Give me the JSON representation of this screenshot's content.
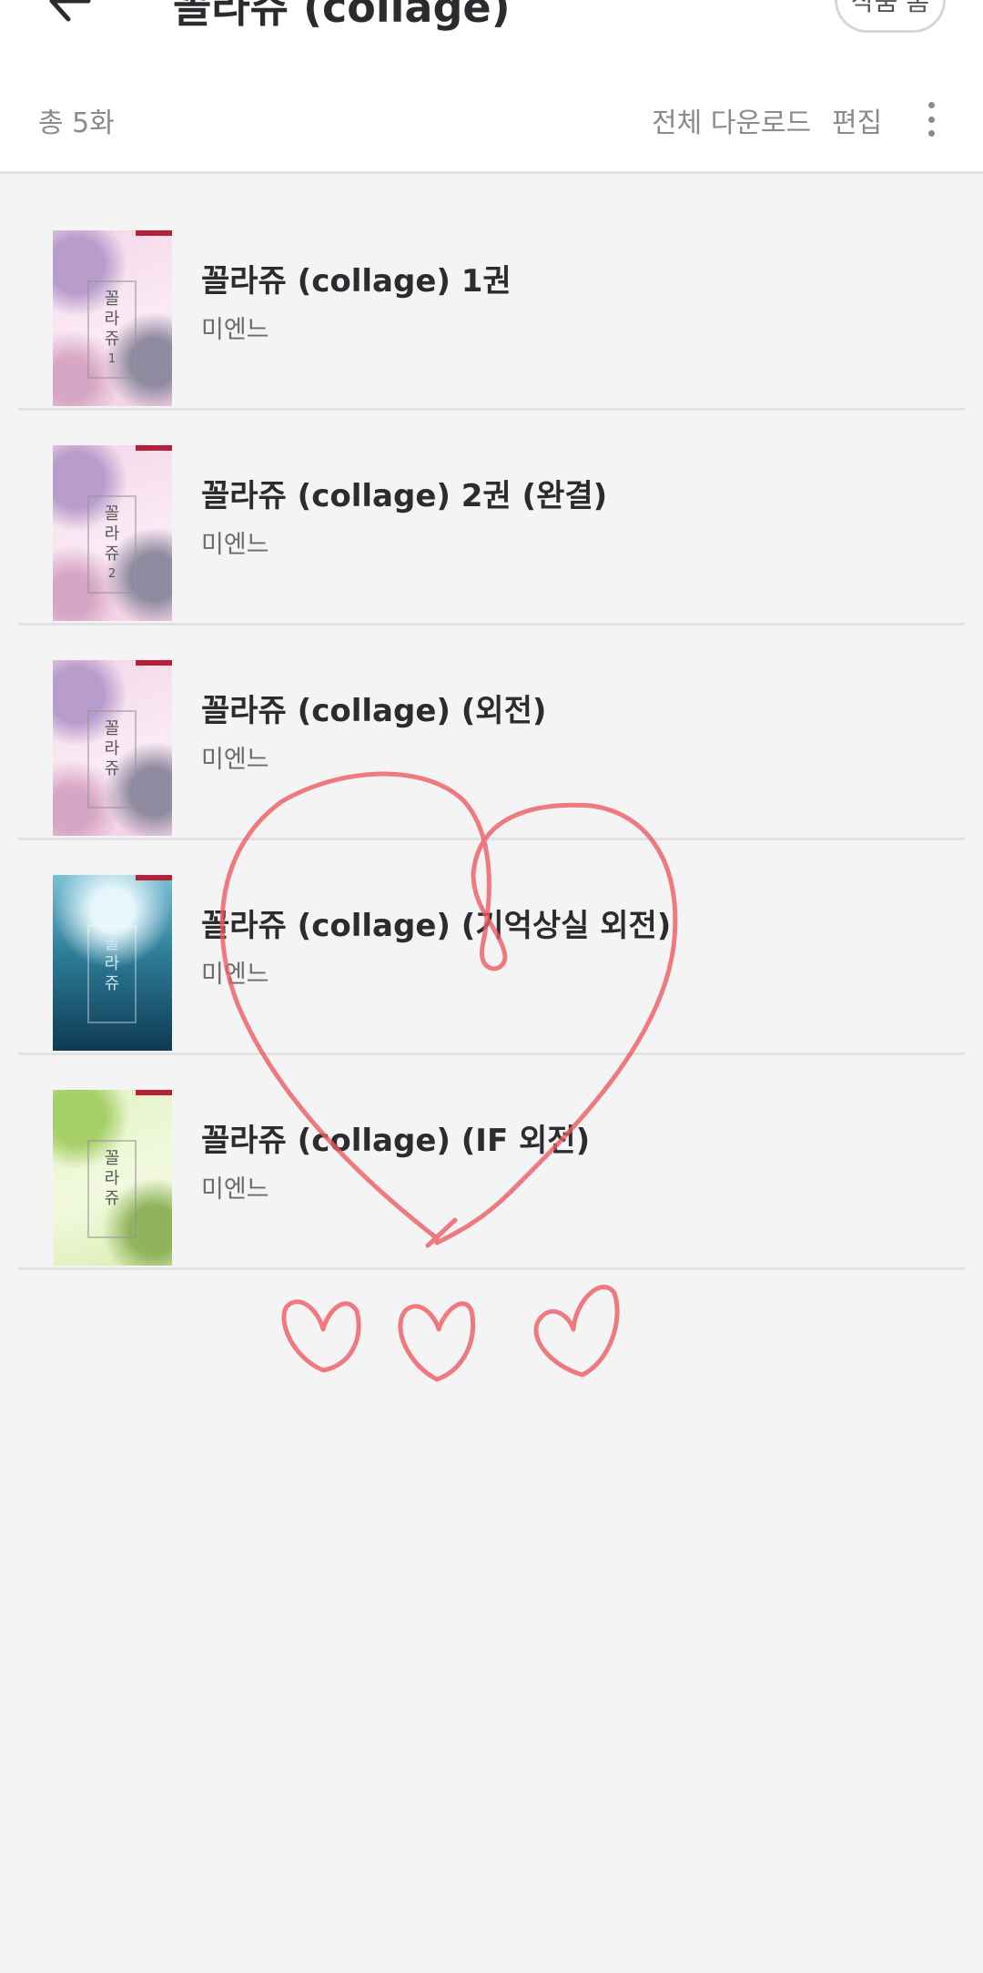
{
  "header": {
    "title": "꼴라쥬 (collage)",
    "pill_label": "작품 홈"
  },
  "toolbar": {
    "count": "총 5화",
    "download_all": "전체 다운로드",
    "edit": "편집"
  },
  "books": [
    {
      "title": "꼴라쥬 (collage) 1권",
      "author": "미엔느",
      "cover": "pink",
      "cover_text": [
        "꼴",
        "라",
        "쥬",
        "1"
      ]
    },
    {
      "title": "꼴라쥬 (collage) 2권 (완결)",
      "author": "미엔느",
      "cover": "pink",
      "cover_text": [
        "꼴",
        "라",
        "쥬",
        "2"
      ]
    },
    {
      "title": "꼴라쥬 (collage) (외전)",
      "author": "미엔느",
      "cover": "pink",
      "cover_text": [
        "꼴",
        "라",
        "쥬",
        ""
      ]
    },
    {
      "title": "꼴라쥬 (collage) (기억상실 외전)",
      "author": "미엔느",
      "cover": "sea",
      "cover_text": [
        "꼴",
        "라",
        "쥬",
        ""
      ]
    },
    {
      "title": "꼴라쥬 (collage) (IF 외전)",
      "author": "미엔느",
      "cover": "green",
      "cover_text": [
        "꼴",
        "라",
        "쥬",
        ""
      ]
    }
  ],
  "colors": {
    "background": "#f4f4f5",
    "header_bg": "#ffffff",
    "doodle": "#ec5b63"
  }
}
